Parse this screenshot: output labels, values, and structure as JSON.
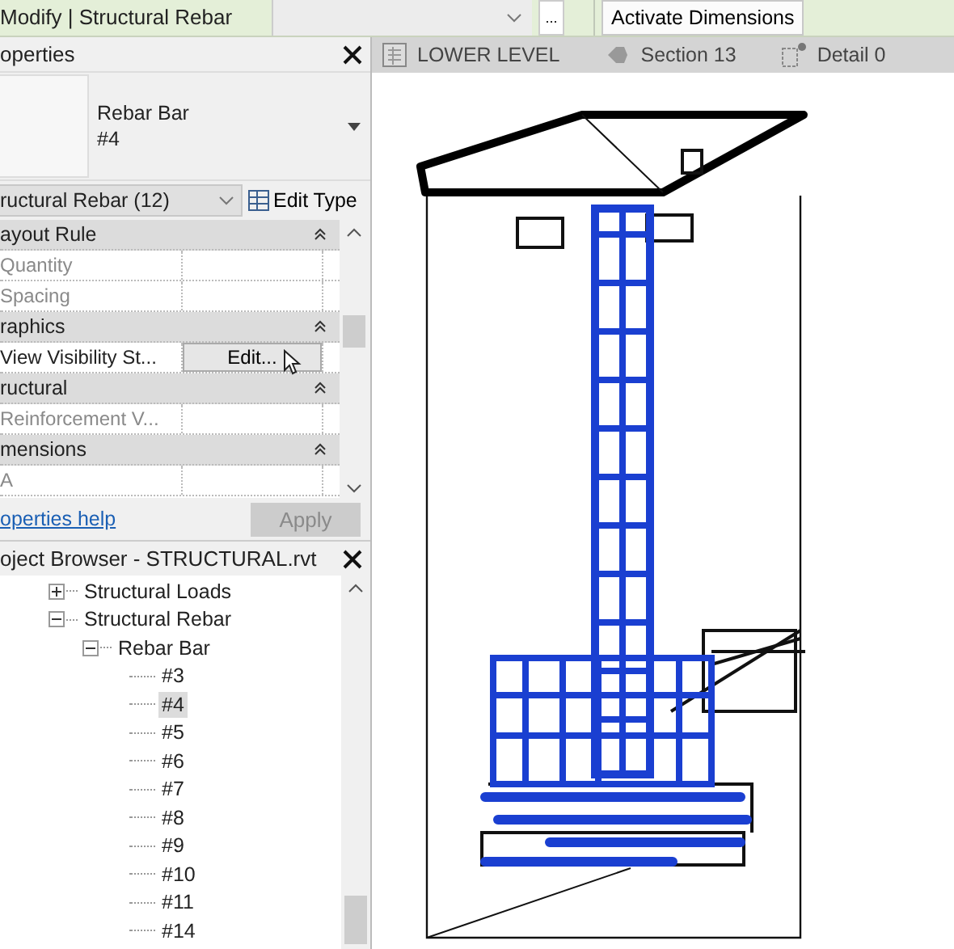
{
  "ribbon": {
    "context_tab": "Modify | Structural Rebar",
    "more_button": "...",
    "activate_button": "Activate Dimensions"
  },
  "properties": {
    "title": "operties",
    "type_name": "Rebar Bar",
    "type_size": "#4",
    "category": "ructural Rebar (12)",
    "edit_type": "Edit Type",
    "rows": [
      {
        "kind": "group",
        "label": "ayout Rule"
      },
      {
        "kind": "param",
        "label": "Quantity",
        "disabled": true
      },
      {
        "kind": "param",
        "label": "Spacing",
        "disabled": true
      },
      {
        "kind": "group",
        "label": "raphics"
      },
      {
        "kind": "button",
        "label": "View Visibility St...",
        "value": "Edit...",
        "disabled": false
      },
      {
        "kind": "group",
        "label": "ructural"
      },
      {
        "kind": "param",
        "label": "Reinforcement V...",
        "disabled": true
      },
      {
        "kind": "group",
        "label": "mensions"
      },
      {
        "kind": "param",
        "label": "A",
        "disabled": true
      }
    ],
    "help_link": "operties help",
    "apply_button": "Apply"
  },
  "view_tabs": [
    {
      "kind": "plan",
      "label": "LOWER LEVEL"
    },
    {
      "kind": "section",
      "label": "Section 13"
    },
    {
      "kind": "detail",
      "label": "Detail 0"
    }
  ],
  "project_browser": {
    "title": "oject Browser - STRUCTURAL.rvt",
    "tree": [
      {
        "label": "Structural Loads",
        "expanded": false
      },
      {
        "label": "Structural Rebar",
        "expanded": true,
        "children": [
          {
            "label": "Rebar Bar",
            "expanded": true,
            "children": [
              {
                "label": "#3",
                "selected": false
              },
              {
                "label": "#4",
                "selected": true
              },
              {
                "label": "#5",
                "selected": false
              },
              {
                "label": "#6",
                "selected": false
              },
              {
                "label": "#7",
                "selected": false
              },
              {
                "label": "#8",
                "selected": false
              },
              {
                "label": "#9",
                "selected": false
              },
              {
                "label": "#10",
                "selected": false
              },
              {
                "label": "#11",
                "selected": false
              },
              {
                "label": "#14",
                "selected": false
              }
            ]
          }
        ]
      }
    ]
  }
}
